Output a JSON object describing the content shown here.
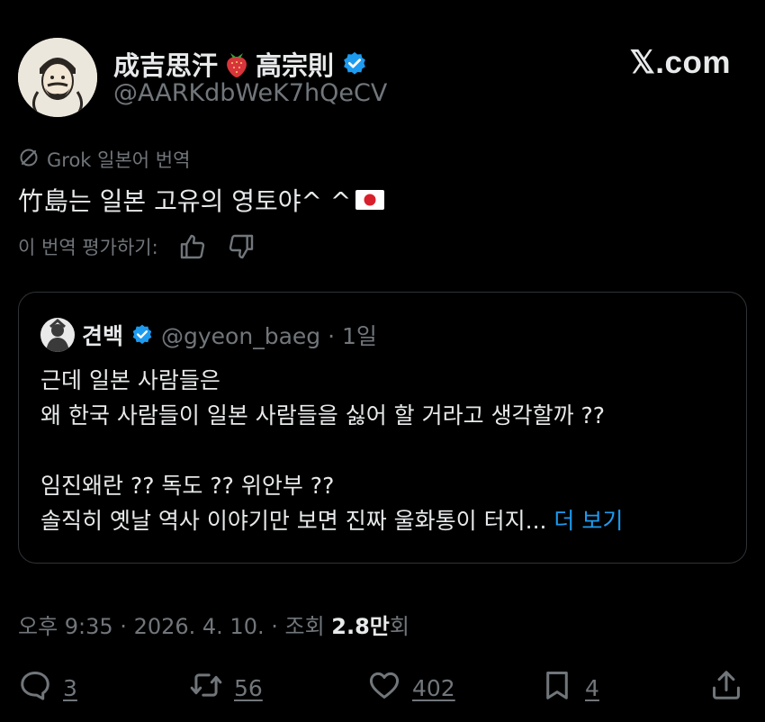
{
  "brand": {
    "logo_text": "𝕏.com"
  },
  "author": {
    "name": "成吉思汗",
    "name_suffix": "高宗則",
    "handle": "@AARKdbWeK7hQeCV"
  },
  "translation": {
    "label": "Grok 일본어 번역",
    "text": "竹島는 일본 고유의 영토야^ ^",
    "rate_label": "이 번역 평가하기:"
  },
  "quote": {
    "name": "견백",
    "handle": "@gyeon_baeg · 1일",
    "lines": [
      "근데 일본 사람들은",
      "왜 한국 사람들이 일본 사람들을 싫어 할 거라고 생각할까 ??",
      "임진왜란 ?? 독도 ?? 위안부 ??",
      "솔직히 옛날 역사 이야기만 보면 진짜 울화통이 터지..."
    ],
    "more_label": " 더 보기"
  },
  "meta": {
    "time": "오후 9:35 · 2026. 4. 10. · 조회 ",
    "views": "2.8만",
    "views_suffix": "회"
  },
  "actions": {
    "replies": "3",
    "reposts": "56",
    "likes": "402",
    "bookmarks": "4"
  },
  "colors": {
    "background": "#000000",
    "text": "#e7e9ea",
    "muted": "#71767b",
    "accent": "#1d9bf0",
    "border": "#2f3336"
  },
  "icons": [
    "grok-icon",
    "verified-icon",
    "strawberry-icon",
    "japan-flag-icon",
    "thumbs-up-icon",
    "thumbs-down-icon",
    "reply-icon",
    "repost-icon",
    "like-icon",
    "bookmark-icon",
    "share-icon"
  ]
}
